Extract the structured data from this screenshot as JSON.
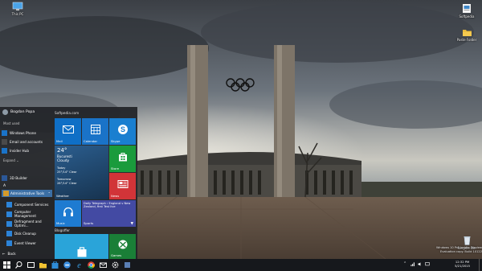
{
  "desktop": {
    "icons": [
      {
        "name": "This PC",
        "icon": "computer-icon"
      },
      {
        "name": "Softpedia",
        "icon": "shortcut-icon"
      },
      {
        "name": "Paste Folder",
        "icon": "folder-icon"
      },
      {
        "name": "Recycle Bin",
        "icon": "recycle-bin-icon"
      }
    ],
    "watermark": {
      "line1": "Windows 10 Pro Insider Preview",
      "line2": "Evaluation copy. Build 10122"
    }
  },
  "start_menu": {
    "user": {
      "name": "Bogdan Popa"
    },
    "most_used": {
      "header": "Most used",
      "items": [
        {
          "label": "Windows Phone",
          "icon": "phone-icon"
        },
        {
          "label": "Email and accounts",
          "icon": "gear-icon"
        },
        {
          "label": "Insider Hub",
          "icon": "megaphone-icon"
        }
      ]
    },
    "expand_label": "Expand",
    "recently_added": {
      "items": [
        {
          "label": "3D Builder",
          "icon": "cube-icon"
        }
      ]
    },
    "letter": "A",
    "admin_tools": {
      "label": "Administrative Tools",
      "items": [
        {
          "label": "Component Services"
        },
        {
          "label": "Computer Management"
        },
        {
          "label": "Defragment and Optimi..."
        },
        {
          "label": "Disk Cleanup"
        },
        {
          "label": "Event Viewer"
        }
      ]
    },
    "back_label": "Back",
    "groups": [
      {
        "title": "Softpedia.com"
      },
      {
        "title": "Blogoffer"
      }
    ],
    "tiles": {
      "mail": {
        "label": "Mail",
        "color": "#0f6fc6"
      },
      "calendar": {
        "label": "Calendar",
        "color": "#1a73c8"
      },
      "skype": {
        "label": "Skype",
        "color": "#00aff0"
      },
      "weather": {
        "label": "Weather",
        "temp": "24°",
        "city": "Bucuresti",
        "condition": "Cloudy",
        "today_label": "Today",
        "today_value": "25°/14° Clear",
        "tomorrow_label": "Tomorrow",
        "tomorrow_value": "28°/14° Clear"
      },
      "store": {
        "label": "Store",
        "color": "#1a9b3c"
      },
      "news": {
        "label": "News",
        "color": "#d13438"
      },
      "music": {
        "label": "Music",
        "color": "#1e7bd1"
      },
      "sports": {
        "label": "Sports",
        "headline": "Daily Telegraph › England v New Zealand, first Test live",
        "color": "#434aa3"
      },
      "shop": {
        "label": "",
        "color": "#2aa4d9"
      },
      "games": {
        "label": "Games",
        "color": "#1a7f37"
      }
    }
  },
  "taskbar": {
    "buttons": [
      {
        "icon": "windows-logo-icon"
      },
      {
        "icon": "search-icon"
      },
      {
        "icon": "task-view-icon"
      },
      {
        "icon": "file-explorer-icon"
      },
      {
        "icon": "store-icon"
      },
      {
        "icon": "edge-browser-icon"
      },
      {
        "icon": "internet-explorer-icon"
      },
      {
        "icon": "chrome-icon"
      },
      {
        "icon": "mail-icon"
      },
      {
        "icon": "settings-icon"
      },
      {
        "icon": "app-icon"
      }
    ],
    "tray_icons": [
      "chevron-up-icon",
      "network-icon",
      "volume-icon",
      "notification-icon"
    ],
    "clock": {
      "time": "12:32 PM",
      "date": "5/21/2015"
    }
  },
  "colors": {
    "accent": "#0f6fc6",
    "taskbar": "#16181c",
    "start_bg": "#222428"
  }
}
